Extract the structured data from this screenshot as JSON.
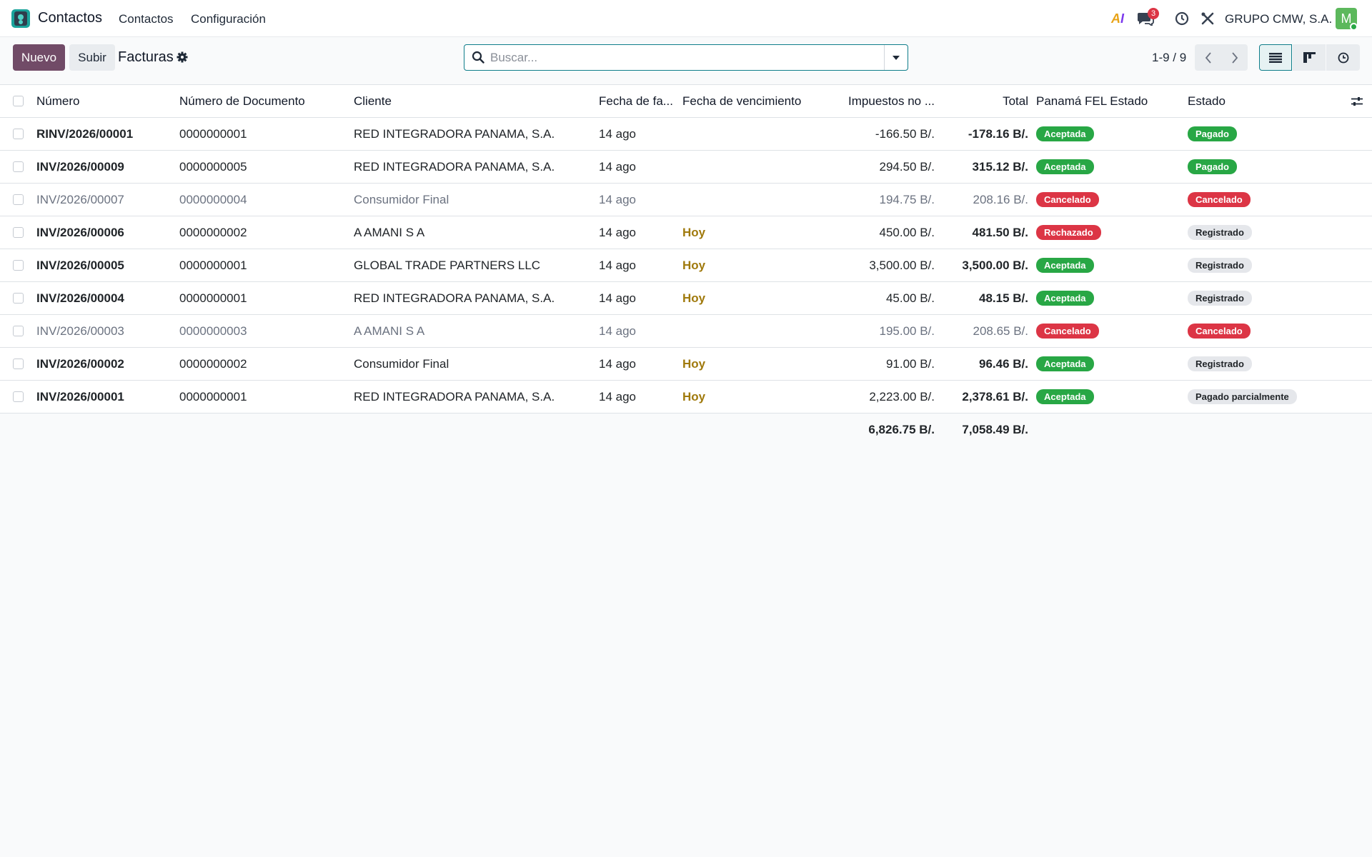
{
  "navbar": {
    "app_name": "Contactos",
    "menus": [
      "Contactos",
      "Configuración"
    ],
    "ai_label": "AI",
    "message_count": "3",
    "company": "GRUPO CMW, S.A.",
    "avatar_initial": "M"
  },
  "control": {
    "new_label": "Nuevo",
    "upload_label": "Subir",
    "title": "Facturas",
    "search_placeholder": "Buscar...",
    "pager": "1-9 / 9"
  },
  "table": {
    "headers": {
      "numero": "Número",
      "documento": "Número de Documento",
      "cliente": "Cliente",
      "fecha": "Fecha de fa...",
      "vencimiento": "Fecha de vencimiento",
      "impuestos": "Impuestos no ...",
      "total": "Total",
      "fel": "Panamá FEL Estado",
      "estado": "Estado"
    },
    "rows": [
      {
        "numero": "RINV/2026/00001",
        "documento": "0000000001",
        "cliente": "RED INTEGRADORA PANAMA, S.A.",
        "fecha": "14 ago",
        "vencimiento": "",
        "impuestos": "-166.50 B/.",
        "total": "-178.16 B/.",
        "fel": "Aceptada",
        "estado": "Pagado"
      },
      {
        "numero": "INV/2026/00009",
        "documento": "0000000005",
        "cliente": "RED INTEGRADORA PANAMA, S.A.",
        "fecha": "14 ago",
        "vencimiento": "",
        "impuestos": "294.50 B/.",
        "total": "315.12 B/.",
        "fel": "Aceptada",
        "estado": "Pagado"
      },
      {
        "numero": "INV/2026/00007",
        "documento": "0000000004",
        "cliente": "Consumidor Final",
        "fecha": "14 ago",
        "vencimiento": "",
        "impuestos": "194.75 B/.",
        "total": "208.16 B/.",
        "fel": "Cancelado",
        "estado": "Cancelado"
      },
      {
        "numero": "INV/2026/00006",
        "documento": "0000000002",
        "cliente": "A AMANI S A",
        "fecha": "14 ago",
        "vencimiento": "Hoy",
        "impuestos": "450.00 B/.",
        "total": "481.50 B/.",
        "fel": "Rechazado",
        "estado": "Registrado"
      },
      {
        "numero": "INV/2026/00005",
        "documento": "0000000001",
        "cliente": "GLOBAL TRADE PARTNERS LLC",
        "fecha": "14 ago",
        "vencimiento": "Hoy",
        "impuestos": "3,500.00 B/.",
        "total": "3,500.00 B/.",
        "fel": "Aceptada",
        "estado": "Registrado"
      },
      {
        "numero": "INV/2026/00004",
        "documento": "0000000001",
        "cliente": "RED INTEGRADORA PANAMA, S.A.",
        "fecha": "14 ago",
        "vencimiento": "Hoy",
        "impuestos": "45.00 B/.",
        "total": "48.15 B/.",
        "fel": "Aceptada",
        "estado": "Registrado"
      },
      {
        "numero": "INV/2026/00003",
        "documento": "0000000003",
        "cliente": "A AMANI S A",
        "fecha": "14 ago",
        "vencimiento": "",
        "impuestos": "195.00 B/.",
        "total": "208.65 B/.",
        "fel": "Cancelado",
        "estado": "Cancelado"
      },
      {
        "numero": "INV/2026/00002",
        "documento": "0000000002",
        "cliente": "Consumidor Final",
        "fecha": "14 ago",
        "vencimiento": "Hoy",
        "impuestos": "91.00 B/.",
        "total": "96.46 B/.",
        "fel": "Aceptada",
        "estado": "Registrado"
      },
      {
        "numero": "INV/2026/00001",
        "documento": "0000000001",
        "cliente": "RED INTEGRADORA PANAMA, S.A.",
        "fecha": "14 ago",
        "vencimiento": "Hoy",
        "impuestos": "2,223.00 B/.",
        "total": "2,378.61 B/.",
        "fel": "Aceptada",
        "estado": "Pagado parcialmente"
      }
    ],
    "totals": {
      "impuestos": "6,826.75 B/.",
      "total": "7,058.49 B/."
    }
  },
  "colors": {
    "brand": "#714b67",
    "accent": "#0f7d8a",
    "success": "#28a745",
    "danger": "#dc3545",
    "due_today": "#a07a0d"
  }
}
